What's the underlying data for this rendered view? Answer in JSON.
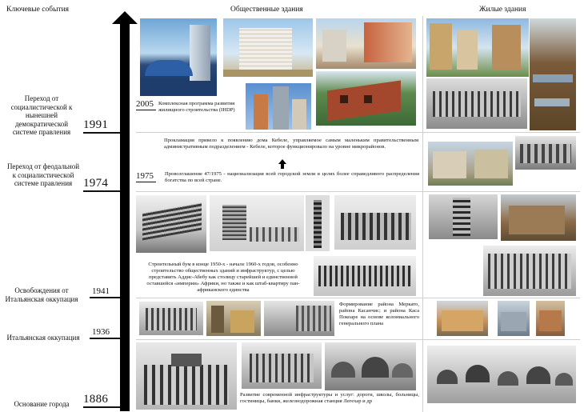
{
  "headers": {
    "events": "Ключевые события",
    "public": "Общественные здания",
    "residential": "Жилые здания"
  },
  "events": [
    {
      "label": "Переход от социалистической к нынешней демократической системе правления",
      "year": "1991"
    },
    {
      "label": "Переход от феодальной к социалистической системе правления",
      "year": "1974"
    },
    {
      "label": "Освобождения от Итальянская оккупация",
      "year": "1941"
    },
    {
      "label": "Итальянская оккупация",
      "year": "1936"
    },
    {
      "label": "Основание города",
      "year": "1886"
    }
  ],
  "sub_years": {
    "y2005": "2005",
    "y1975": "1975"
  },
  "texts": {
    "t2005": "Комплексная программа развития жилищного строительства (IHDP)",
    "kebele": "Прокламация привело к появлению дома Кебеле, управляемое самым маленьким правительственным административным подразделением - Кебеле, которое функционировало на уровне микрорайонов.",
    "t1975": "Провозглашение 47/1975 - национализация всей городской земли в целях более справедливого распределения богатства по всей стране.",
    "boom": "Строительный бум в конце 1950-х - начале 1960-х годов, особенно строительство общественных зданий и инфраструктур, с целью представить Аддис-Абебу как столицу старейшей и единственной оставшейся «империи» Африки, но также и как штаб-квартиру пан-африканского единства",
    "merkato": "Формирование района Меркато, района Касанчис; и района Каса Покоаре на основе колониального генерального плана",
    "infra": "Развитие современной инфраструктуры и услуг: дороги, школы, больницы, гостиницы, банки, железнодорожная станция Легехар и др"
  },
  "colors": {
    "axis": "#000000",
    "separator": "#cfcfcf"
  }
}
